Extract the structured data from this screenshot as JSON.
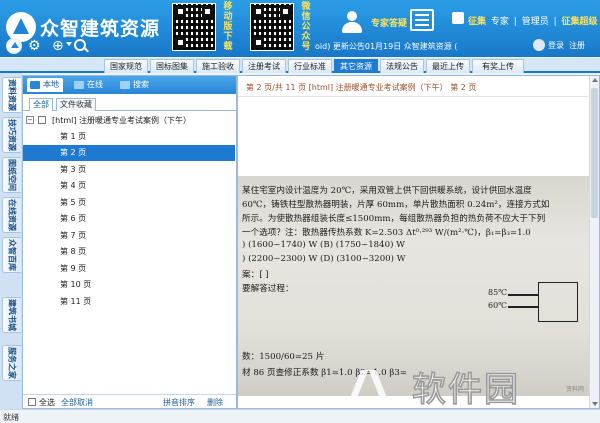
{
  "header": {
    "app_title": "众智建筑资源",
    "qr1_caption": "移动版下载",
    "qr2_caption": "微信公众号",
    "expert_answer": "专家答疑",
    "links": [
      "征集",
      "专家",
      "|",
      "管理员",
      "|",
      "征集超级"
    ]
  },
  "toolbar": {
    "notice": "oid) 更新公告01月19日    众智建筑资源 (",
    "login": "登录",
    "register": "注册"
  },
  "tabs": [
    {
      "label": "国家规范"
    },
    {
      "label": "国标图集"
    },
    {
      "label": "施工验收"
    },
    {
      "label": "注册考试"
    },
    {
      "label": "行业标准"
    },
    {
      "label": "其它资源"
    },
    {
      "label": "法规公告"
    },
    {
      "label": "最近上传"
    },
    {
      "label": "有奖上传"
    }
  ],
  "vtabs": [
    {
      "label": "资料资源"
    },
    {
      "label": "技巧资源"
    },
    {
      "label": "图纸空间"
    },
    {
      "label": "在线资源"
    },
    {
      "label": "众智百库"
    },
    {
      "label": "建筑书城"
    },
    {
      "label": "服务之家"
    }
  ],
  "left_panel": {
    "tabs": [
      "本地",
      "在线",
      "搜索"
    ],
    "filter_tabs": [
      "全部",
      "文件收藏"
    ],
    "root_expand": "−",
    "root_label": "[html] 注册暖通专业考试案例（下午）",
    "pages": [
      "第 1 页",
      "第 2 页",
      "第 3 页",
      "第 4 页",
      "第 5 页",
      "第 6 页",
      "第 7 页",
      "第 8 页",
      "第 9 页",
      "第 10 页",
      "第 11 页"
    ],
    "selected_page_index": 1,
    "bottom": {
      "select_all": "全选",
      "cancel_all": "全部取消",
      "sort": "拼音排序",
      "delete": "删除"
    }
  },
  "document": {
    "header": "第 2 页/共 11 页   [html] 注册暖通专业考试案例（下午）   第 2 页",
    "scan_lines": [
      "某住宅室内设计温度为 20℃，采用双管上供下回供暖系统，设计供回水温度",
      "60℃，铸铁柱型散热器明装，片厚 60mm，单片散热面积 0.24m²，连接方式如",
      "所示。为使散热器组装长度≤1500mm，每组散热器负担的热负荷不应大于下列",
      "一个选项？注：散热器传热系数 K=2.503 Δt⁰·²⁹³ W/(m²·℃)，β₁=β₃=1.0",
      ") (1600~1740) W          (B) (1750~1840) W",
      ") (2200~2300) W          (D) (3100~3200) W",
      "案：[        ]",
      "要解答过程：",
      "",
      "",
      "数：1500/60=25 片",
      "材 86 页查修正系数 β1=1.0  β2=1.0  β3="
    ],
    "diagram_labels": [
      "85℃",
      "60℃"
    ],
    "scan_footer": "资料网"
  },
  "watermark": "软件园",
  "status": "就绪",
  "colors": {
    "header_blue": "#1f86d6",
    "selected_row": "#1d7ad0",
    "highlight_yellow": "#ffe35a"
  }
}
